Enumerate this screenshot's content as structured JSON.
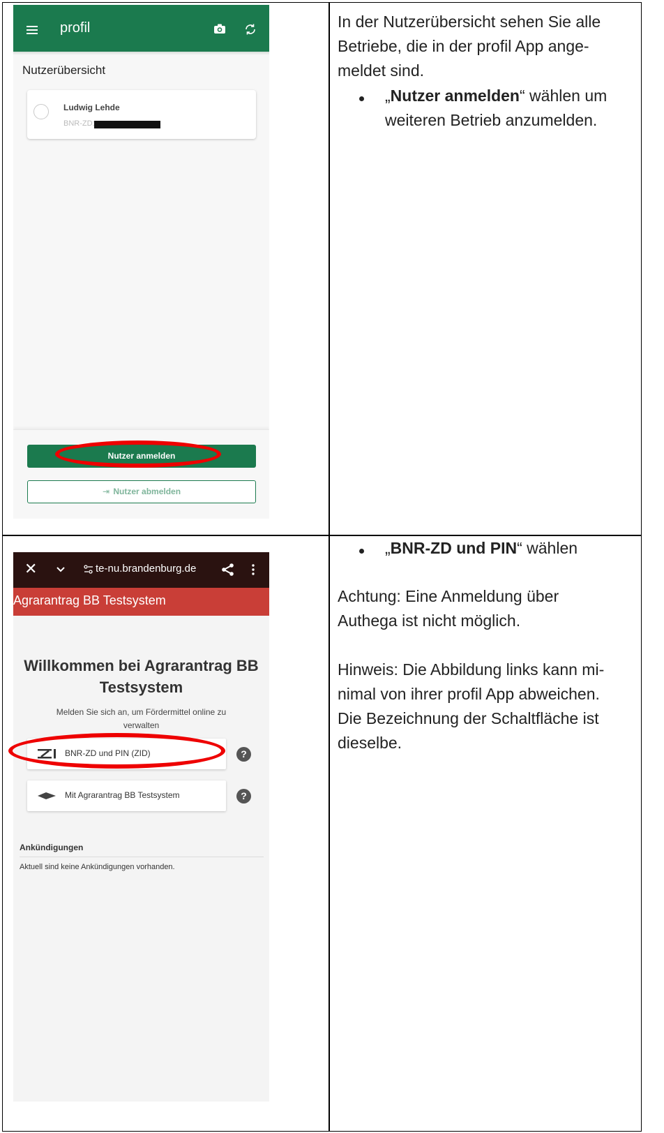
{
  "left_top": {
    "app_title": "profil",
    "page_heading": "Nutzerübersicht",
    "user_name": "Ludwig Lehde",
    "user_id_label": "BNR-ZD:",
    "login_button": "Nutzer anmelden",
    "logout_button": "Nutzer abmelden",
    "icons": [
      "menu-icon",
      "camera-icon",
      "sync-icon",
      "logout-icon"
    ],
    "accent_color": "#1b7a4e"
  },
  "left_bottom": {
    "url": "te-nu.brandenburg.de",
    "site_title": "Agrarantrag BB Testsystem",
    "welcome_line1": "Willkommen bei Agrarantrag BB",
    "welcome_line2": "Testsystem",
    "subtitle_line1": "Melden Sie sich an, um Fördermittel online zu",
    "subtitle_line2": "verwalten",
    "option1": "BNR-ZD und PIN (ZID)",
    "option2": "Mit Agrarantrag BB Testsystem",
    "help_glyph": "?",
    "announcements_heading": "Ankündigungen",
    "announcements_text": "Aktuell sind keine Ankündigungen vorhanden.",
    "header_color": "#c93e37"
  },
  "right_top": {
    "line1": "In der Nutzerübersicht sehen Sie alle",
    "line2": "Betriebe, die in der profil App ange-",
    "line3": "meldet sind.",
    "bullet_quote_open": "„",
    "bullet_bold": "Nutzer anmelden",
    "bullet_rest": "“ wählen um",
    "bullet_line2": "weiteren Betrieb anzumelden."
  },
  "right_bottom": {
    "bullet_quote_open": "„",
    "bullet_bold": "BNR-ZD und PIN",
    "bullet_rest": "“ wählen",
    "achtung_line1": "Achtung: Eine Anmeldung über",
    "achtung_line2": "Authega ist nicht möglich.",
    "hinweis_line1": "Hinweis: Die Abbildung links kann mi-",
    "hinweis_line2": "nimal von ihrer profil App abweichen.",
    "hinweis_line3": "Die Bezeichnung der Schaltfläche ist",
    "hinweis_line4": "dieselbe."
  }
}
